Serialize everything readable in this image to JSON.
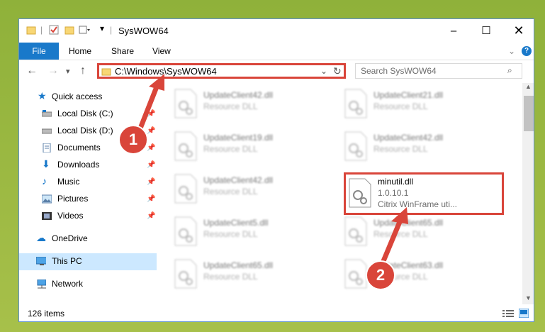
{
  "window": {
    "title": "SysWOW64"
  },
  "ribbon": {
    "file": "File",
    "home": "Home",
    "share": "Share",
    "view": "View"
  },
  "nav": {
    "address": "C:\\Windows\\SysWOW64",
    "search_placeholder": "Search SysWOW64"
  },
  "sidebar": {
    "items": [
      {
        "label": "Quick access",
        "icon": "star-icon"
      },
      {
        "label": "Local Disk (C:)",
        "icon": "drive-icon"
      },
      {
        "label": "Local Disk (D:)",
        "icon": "drive-icon"
      },
      {
        "label": "Documents",
        "icon": "documents-icon"
      },
      {
        "label": "Downloads",
        "icon": "download-icon"
      },
      {
        "label": "Music",
        "icon": "music-icon"
      },
      {
        "label": "Pictures",
        "icon": "pictures-icon"
      },
      {
        "label": "Videos",
        "icon": "videos-icon"
      },
      {
        "label": "OneDrive",
        "icon": "cloud-icon"
      },
      {
        "label": "This PC",
        "icon": "pc-icon"
      },
      {
        "label": "Network",
        "icon": "network-icon"
      }
    ]
  },
  "files": [
    {
      "name": "UpdateClient42.dll",
      "type": "Resource DLL"
    },
    {
      "name": "UpdateClient21.dll",
      "type": "Resource DLL"
    },
    {
      "name": "UpdateClient19.dll",
      "type": "Resource DLL"
    },
    {
      "name": "UpdateClient42.dll",
      "type": "Resource DLL"
    },
    {
      "name": "UpdateClient42.dll",
      "type": "Resource DLL"
    },
    {
      "name": "minutil.dll",
      "version": "1.0.10.1",
      "type": "Citrix WinFrame uti..."
    },
    {
      "name": "UpdateClient5.dll",
      "type": "Resource DLL"
    },
    {
      "name": "UpdateClient65.dll",
      "type": "Resource DLL"
    },
    {
      "name": "UpdateClient65.dll",
      "type": "Resource DLL"
    },
    {
      "name": "UpdateClient63.dll",
      "type": "Resource DLL"
    }
  ],
  "status": {
    "count": "126 items"
  },
  "callouts": [
    "1",
    "2"
  ],
  "colors": {
    "accent": "#1979ca",
    "highlight": "#d9453a",
    "selected": "#cce8ff"
  }
}
